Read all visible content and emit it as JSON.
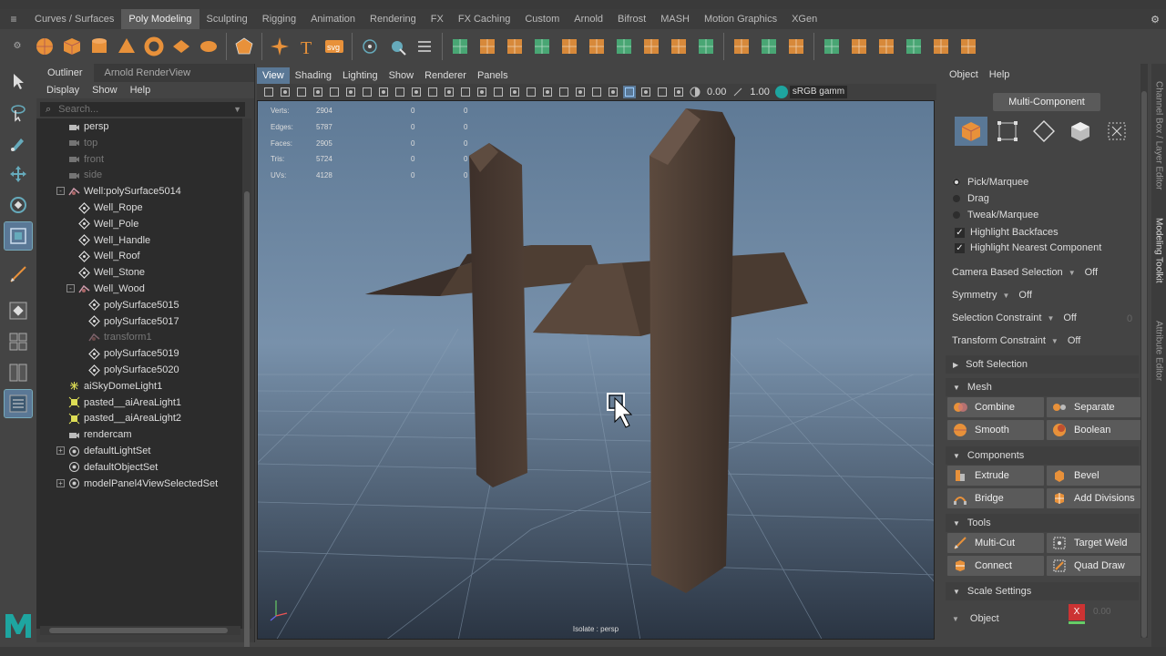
{
  "shelf_tabs": [
    "Curves / Surfaces",
    "Poly Modeling",
    "Sculpting",
    "Rigging",
    "Animation",
    "Rendering",
    "FX",
    "FX Caching",
    "Custom",
    "Arnold",
    "Bifrost",
    "MASH",
    "Motion Graphics",
    "XGen"
  ],
  "shelf_active_index": 1,
  "shelf_icons": [
    "sphere-icon",
    "cube-icon",
    "cylinder-icon",
    "cone-icon",
    "torus-icon",
    "plane-icon",
    "disc-icon",
    "sep",
    "platonic-icon",
    "sep",
    "super-shape-icon",
    "text-icon",
    "svg-icon",
    "sep",
    "sphere-orb-icon",
    "sweep-icon",
    "grid-icon",
    "sep",
    "combine-icon",
    "separate-icon",
    "mirror-icon",
    "smooth-icon",
    "reduce-icon",
    "remesh-icon",
    "bevel-icon",
    "bridge-icon",
    "fill-hole-icon",
    "extrude-icon",
    "sep",
    "multi-cut-icon",
    "edge-loop-icon",
    "mirror-cut-icon",
    "sep",
    "uv-icon",
    "uv-editor-icon",
    "uv-layout-icon",
    "uv-unfold-icon",
    "uv-sew-icon",
    "checker-icon"
  ],
  "svg_label": "svg",
  "text_tool_label": "T",
  "outliner": {
    "tabs": [
      "Outliner",
      "Arnold RenderView"
    ],
    "menu": [
      "Display",
      "Show",
      "Help"
    ],
    "search_placeholder": "Search...",
    "items": [
      {
        "label": "persp",
        "icon": "camera-icon",
        "indent": 0,
        "dim": false,
        "expander": ""
      },
      {
        "label": "top",
        "icon": "camera-icon",
        "indent": 0,
        "dim": true,
        "expander": ""
      },
      {
        "label": "front",
        "icon": "camera-icon",
        "indent": 0,
        "dim": true,
        "expander": ""
      },
      {
        "label": "side",
        "icon": "camera-icon",
        "indent": 0,
        "dim": true,
        "expander": ""
      },
      {
        "label": "Well:polySurface5014",
        "icon": "group-icon",
        "indent": 0,
        "dim": false,
        "expander": "-"
      },
      {
        "label": "Well_Rope",
        "icon": "mesh-icon",
        "indent": 1,
        "dim": false,
        "expander": ""
      },
      {
        "label": "Well_Pole",
        "icon": "mesh-icon",
        "indent": 1,
        "dim": false,
        "expander": ""
      },
      {
        "label": "Well_Handle",
        "icon": "mesh-icon",
        "indent": 1,
        "dim": false,
        "expander": ""
      },
      {
        "label": "Well_Roof",
        "icon": "mesh-icon",
        "indent": 1,
        "dim": false,
        "expander": ""
      },
      {
        "label": "Well_Stone",
        "icon": "mesh-icon",
        "indent": 1,
        "dim": false,
        "expander": ""
      },
      {
        "label": "Well_Wood",
        "icon": "group-icon",
        "indent": 1,
        "dim": false,
        "expander": "-"
      },
      {
        "label": "polySurface5015",
        "icon": "mesh-icon",
        "indent": 2,
        "dim": false,
        "expander": ""
      },
      {
        "label": "polySurface5017",
        "icon": "mesh-icon",
        "indent": 2,
        "dim": false,
        "expander": ""
      },
      {
        "label": "transform1",
        "icon": "group-icon",
        "indent": 2,
        "dim": true,
        "expander": ""
      },
      {
        "label": "polySurface5019",
        "icon": "mesh-icon",
        "indent": 2,
        "dim": false,
        "expander": ""
      },
      {
        "label": "polySurface5020",
        "icon": "mesh-icon",
        "indent": 2,
        "dim": false,
        "expander": ""
      },
      {
        "label": "aiSkyDomeLight1",
        "icon": "light-icon",
        "indent": 0,
        "dim": false,
        "expander": ""
      },
      {
        "label": "pasted__aiAreaLight1",
        "icon": "area-light-icon",
        "indent": 0,
        "dim": false,
        "expander": ""
      },
      {
        "label": "pasted__aiAreaLight2",
        "icon": "area-light-icon",
        "indent": 0,
        "dim": false,
        "expander": ""
      },
      {
        "label": "rendercam",
        "icon": "camera-icon",
        "indent": 0,
        "dim": false,
        "expander": ""
      },
      {
        "label": "defaultLightSet",
        "icon": "set-icon",
        "indent": 0,
        "dim": false,
        "expander": "+"
      },
      {
        "label": "defaultObjectSet",
        "icon": "set-icon",
        "indent": 0,
        "dim": false,
        "expander": ""
      },
      {
        "label": "modelPanel4ViewSelectedSet",
        "icon": "set-icon",
        "indent": 0,
        "dim": false,
        "expander": "+"
      }
    ]
  },
  "viewport": {
    "menu": [
      "View",
      "Shading",
      "Lighting",
      "Show",
      "Renderer",
      "Panels"
    ],
    "menu_active_index": 0,
    "field1": "0.00",
    "field2": "1.00",
    "color_space": "sRGB gamm",
    "hud": [
      {
        "label": "Verts:",
        "a": "2904",
        "b": "0",
        "c": "0"
      },
      {
        "label": "Edges:",
        "a": "5787",
        "b": "0",
        "c": "0"
      },
      {
        "label": "Faces:",
        "a": "2905",
        "b": "0",
        "c": "0"
      },
      {
        "label": "Tris:",
        "a": "5724",
        "b": "0",
        "c": "0"
      },
      {
        "label": "UVs:",
        "a": "4128",
        "b": "0",
        "c": "0"
      }
    ],
    "isolate_label": "Isolate : persp"
  },
  "modeling_toolkit": {
    "menu": [
      "Object",
      "Help"
    ],
    "mode_button": "Multi-Component",
    "component_modes": [
      "object-mode-icon",
      "vertex-mode-icon",
      "edge-mode-icon",
      "face-mode-icon",
      "uv-mode-icon"
    ],
    "selection_modes": [
      {
        "label": "Pick/Marquee",
        "on": true
      },
      {
        "label": "Drag",
        "on": false
      },
      {
        "label": "Tweak/Marquee",
        "on": false
      }
    ],
    "checkboxes": [
      "Highlight Backfaces",
      "Highlight Nearest Component"
    ],
    "options": [
      {
        "label": "Camera Based Selection",
        "value": "Off",
        "extra": ""
      },
      {
        "label": "Symmetry",
        "value": "Off",
        "extra": ""
      },
      {
        "label": "Selection Constraint",
        "value": "Off",
        "extra": "0"
      },
      {
        "label": "Transform Constraint",
        "value": "Off",
        "extra": ""
      }
    ],
    "soft_selection": "Soft Selection",
    "mesh_section": "Mesh",
    "mesh_buttons": [
      "Combine",
      "Separate",
      "Smooth",
      "Boolean"
    ],
    "components_section": "Components",
    "component_buttons": [
      "Extrude",
      "Bevel",
      "Bridge",
      "Add Divisions"
    ],
    "tools_section": "Tools",
    "tool_buttons": [
      "Multi-Cut",
      "Target Weld",
      "Connect",
      "Quad Draw"
    ],
    "scale_section": "Scale Settings",
    "scale_object": "Object",
    "scale_x_label": "X",
    "scale_value": "0.00"
  },
  "side_tabs": [
    "Channel Box / Layer Editor",
    "Modeling Toolkit",
    "Attribute Editor"
  ],
  "side_tab_active_index": 1,
  "colors": {
    "accent": "#5a7896",
    "shelf_orange": "#e8913a",
    "wood": "#4a3a2f"
  }
}
